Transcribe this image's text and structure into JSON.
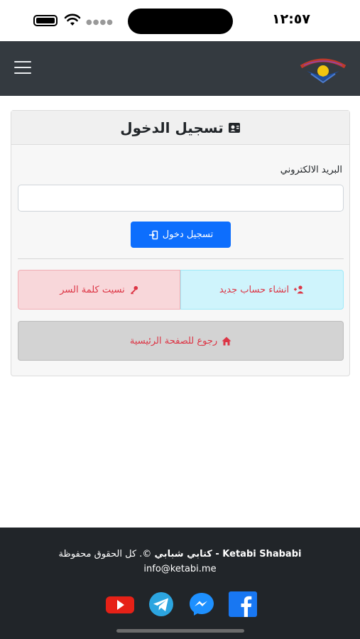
{
  "status_bar": {
    "time": "١٢:٥٧"
  },
  "navbar": {
    "menu_icon": "hamburger-menu-icon",
    "logo": "site-logo"
  },
  "login_card": {
    "title": "تسجيل الدخول",
    "title_icon": "address-card-icon",
    "email_label": "البريد الالكتروني",
    "email_value": "",
    "email_placeholder": "",
    "login_button": "تسجيل دخول",
    "login_icon": "sign-in-icon",
    "signup_button": "انشاء حساب جديد",
    "signup_icon": "user-plus-icon",
    "forgot_button": "نسيت كلمة السر",
    "forgot_icon": "key-icon",
    "home_button": "رجوع للصفحة الرئيسية",
    "home_icon": "home-icon"
  },
  "footer": {
    "brand": "Ketabi Shababi - كتابي شبابي",
    "copyright_rest": " ©. كل الحقوق محفوظة",
    "email": "info@ketabi.me",
    "socials": [
      "youtube-icon",
      "telegram-icon",
      "messenger-icon",
      "facebook-icon"
    ]
  },
  "colors": {
    "navbar_bg": "#343a40",
    "footer_bg": "#212529",
    "primary": "#0d6efd",
    "danger_text": "#dc3545",
    "info_bg": "#cff4fc",
    "danger_bg": "#f8d7da",
    "home_bg": "#d3d3d3"
  }
}
